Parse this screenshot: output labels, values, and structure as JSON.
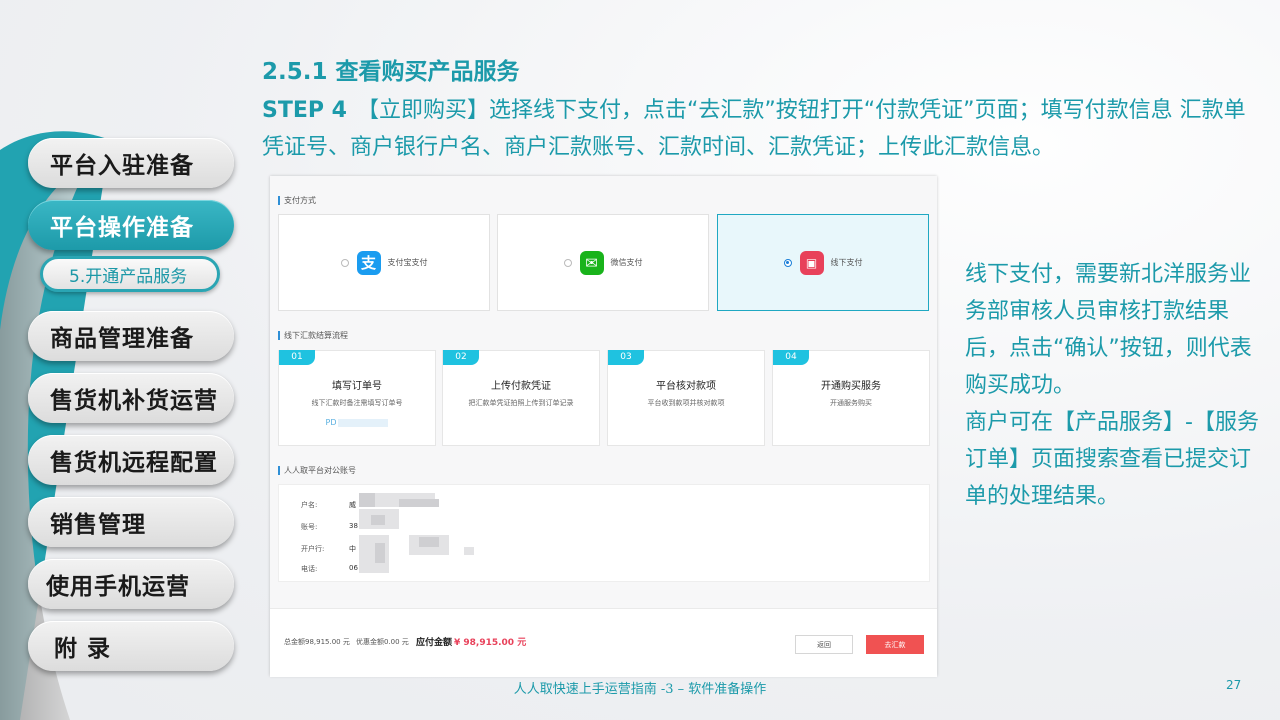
{
  "sidebar": {
    "items": [
      {
        "label": "平台入驻准备"
      },
      {
        "label": "平台操作准备"
      },
      {
        "label": "商品管理准备"
      },
      {
        "label": "售货机补货运营"
      },
      {
        "label": "售货机远程配置"
      },
      {
        "label": "销售管理"
      },
      {
        "label": "使用手机运营"
      },
      {
        "label": "附 录"
      }
    ],
    "sub_item": "5.开通产品服务"
  },
  "heading": {
    "title": "2.5.1 查看购买产品服务",
    "step_no": "STEP 4",
    "step_text": "【立即购买】选择线下支付，点击“去汇款”按钮打开“付款凭证”页面；填写付款信息 汇款单凭证号、商户银行户名、商户汇款账号、汇款时间、汇款凭证；上传此汇款信息。"
  },
  "screenshot": {
    "pay_section_label": "支付方式",
    "pay_methods": [
      {
        "label": "支付宝支付",
        "icon": "alipay-icon",
        "color": "#1a9cf0",
        "glyph": "支"
      },
      {
        "label": "微信支付",
        "icon": "wechat-icon",
        "color": "#19b31b",
        "glyph": "✉"
      },
      {
        "label": "线下支付",
        "icon": "wallet-icon",
        "color": "#e8415a",
        "glyph": "▣"
      }
    ],
    "flow_section_label": "线下汇款结算流程",
    "steps": [
      {
        "no": "01",
        "title": "填写订单号",
        "desc": "线下汇款时备注需填写订单号",
        "extra": "PD"
      },
      {
        "no": "02",
        "title": "上传付款凭证",
        "desc": "把汇款单凭证拍照上传到订单记录",
        "extra": ""
      },
      {
        "no": "03",
        "title": "平台核对款项",
        "desc": "平台收到款项并核对款项",
        "extra": ""
      },
      {
        "no": "04",
        "title": "开通购买服务",
        "desc": "开通服务购买",
        "extra": ""
      }
    ],
    "account_section_label": "人人取平台对公账号",
    "account_rows": [
      {
        "label": "户名:",
        "value": "威"
      },
      {
        "label": "账号:",
        "value": "38"
      },
      {
        "label": "开户行:",
        "value": "中"
      },
      {
        "label": "电话:",
        "value": "06"
      }
    ],
    "summary": {
      "total": "总金额98,915.00 元",
      "discount": "优惠金额0.00 元",
      "payable_label": "应付金额",
      "payable_value": "¥ 98,915.00 元"
    },
    "buttons": {
      "back": "返回",
      "remit": "去汇款"
    }
  },
  "right_text": {
    "p1": "线下支付，需要新北洋服务业务部审核人员审核打款结果后，点击“确认”按钮，则代表购买成功。",
    "p2": "商户可在【产品服务】-【服务订单】页面搜索查看已提交订单的处理结果。"
  },
  "footer": {
    "text": "人人取快速上手运营指南 -3 – 软件准备操作",
    "page": "27"
  },
  "colors": {
    "accent": "#1c9aaa",
    "remit_button": "#f05252",
    "amount": "#e8415a"
  }
}
